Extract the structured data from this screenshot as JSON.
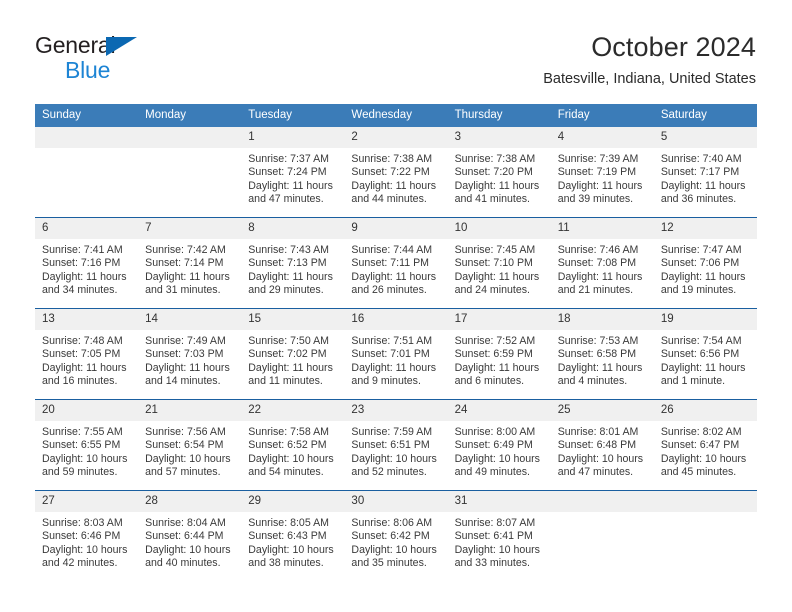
{
  "logo": {
    "word1": "General",
    "word2": "Blue",
    "triangle_color": "#0b68b2",
    "word2_color": "#1d84d4"
  },
  "header": {
    "title": "October 2024",
    "subtitle": "Batesville, Indiana, United States"
  },
  "theme": {
    "header_blue": "#3b7cb8",
    "row_rule": "#1a5fa0",
    "daynum_band": "#f0f0f0"
  },
  "calendar": {
    "weekdays": [
      "Sunday",
      "Monday",
      "Tuesday",
      "Wednesday",
      "Thursday",
      "Friday",
      "Saturday"
    ],
    "weeks": [
      [
        {
          "day": "",
          "blank": true
        },
        {
          "day": "",
          "blank": true
        },
        {
          "day": "1",
          "sunrise": "Sunrise: 7:37 AM",
          "sunset": "Sunset: 7:24 PM",
          "daylight": "Daylight: 11 hours and 47 minutes."
        },
        {
          "day": "2",
          "sunrise": "Sunrise: 7:38 AM",
          "sunset": "Sunset: 7:22 PM",
          "daylight": "Daylight: 11 hours and 44 minutes."
        },
        {
          "day": "3",
          "sunrise": "Sunrise: 7:38 AM",
          "sunset": "Sunset: 7:20 PM",
          "daylight": "Daylight: 11 hours and 41 minutes."
        },
        {
          "day": "4",
          "sunrise": "Sunrise: 7:39 AM",
          "sunset": "Sunset: 7:19 PM",
          "daylight": "Daylight: 11 hours and 39 minutes."
        },
        {
          "day": "5",
          "sunrise": "Sunrise: 7:40 AM",
          "sunset": "Sunset: 7:17 PM",
          "daylight": "Daylight: 11 hours and 36 minutes."
        }
      ],
      [
        {
          "day": "6",
          "sunrise": "Sunrise: 7:41 AM",
          "sunset": "Sunset: 7:16 PM",
          "daylight": "Daylight: 11 hours and 34 minutes."
        },
        {
          "day": "7",
          "sunrise": "Sunrise: 7:42 AM",
          "sunset": "Sunset: 7:14 PM",
          "daylight": "Daylight: 11 hours and 31 minutes."
        },
        {
          "day": "8",
          "sunrise": "Sunrise: 7:43 AM",
          "sunset": "Sunset: 7:13 PM",
          "daylight": "Daylight: 11 hours and 29 minutes."
        },
        {
          "day": "9",
          "sunrise": "Sunrise: 7:44 AM",
          "sunset": "Sunset: 7:11 PM",
          "daylight": "Daylight: 11 hours and 26 minutes."
        },
        {
          "day": "10",
          "sunrise": "Sunrise: 7:45 AM",
          "sunset": "Sunset: 7:10 PM",
          "daylight": "Daylight: 11 hours and 24 minutes."
        },
        {
          "day": "11",
          "sunrise": "Sunrise: 7:46 AM",
          "sunset": "Sunset: 7:08 PM",
          "daylight": "Daylight: 11 hours and 21 minutes."
        },
        {
          "day": "12",
          "sunrise": "Sunrise: 7:47 AM",
          "sunset": "Sunset: 7:06 PM",
          "daylight": "Daylight: 11 hours and 19 minutes."
        }
      ],
      [
        {
          "day": "13",
          "sunrise": "Sunrise: 7:48 AM",
          "sunset": "Sunset: 7:05 PM",
          "daylight": "Daylight: 11 hours and 16 minutes."
        },
        {
          "day": "14",
          "sunrise": "Sunrise: 7:49 AM",
          "sunset": "Sunset: 7:03 PM",
          "daylight": "Daylight: 11 hours and 14 minutes."
        },
        {
          "day": "15",
          "sunrise": "Sunrise: 7:50 AM",
          "sunset": "Sunset: 7:02 PM",
          "daylight": "Daylight: 11 hours and 11 minutes."
        },
        {
          "day": "16",
          "sunrise": "Sunrise: 7:51 AM",
          "sunset": "Sunset: 7:01 PM",
          "daylight": "Daylight: 11 hours and 9 minutes."
        },
        {
          "day": "17",
          "sunrise": "Sunrise: 7:52 AM",
          "sunset": "Sunset: 6:59 PM",
          "daylight": "Daylight: 11 hours and 6 minutes."
        },
        {
          "day": "18",
          "sunrise": "Sunrise: 7:53 AM",
          "sunset": "Sunset: 6:58 PM",
          "daylight": "Daylight: 11 hours and 4 minutes."
        },
        {
          "day": "19",
          "sunrise": "Sunrise: 7:54 AM",
          "sunset": "Sunset: 6:56 PM",
          "daylight": "Daylight: 11 hours and 1 minute."
        }
      ],
      [
        {
          "day": "20",
          "sunrise": "Sunrise: 7:55 AM",
          "sunset": "Sunset: 6:55 PM",
          "daylight": "Daylight: 10 hours and 59 minutes."
        },
        {
          "day": "21",
          "sunrise": "Sunrise: 7:56 AM",
          "sunset": "Sunset: 6:54 PM",
          "daylight": "Daylight: 10 hours and 57 minutes."
        },
        {
          "day": "22",
          "sunrise": "Sunrise: 7:58 AM",
          "sunset": "Sunset: 6:52 PM",
          "daylight": "Daylight: 10 hours and 54 minutes."
        },
        {
          "day": "23",
          "sunrise": "Sunrise: 7:59 AM",
          "sunset": "Sunset: 6:51 PM",
          "daylight": "Daylight: 10 hours and 52 minutes."
        },
        {
          "day": "24",
          "sunrise": "Sunrise: 8:00 AM",
          "sunset": "Sunset: 6:49 PM",
          "daylight": "Daylight: 10 hours and 49 minutes."
        },
        {
          "day": "25",
          "sunrise": "Sunrise: 8:01 AM",
          "sunset": "Sunset: 6:48 PM",
          "daylight": "Daylight: 10 hours and 47 minutes."
        },
        {
          "day": "26",
          "sunrise": "Sunrise: 8:02 AM",
          "sunset": "Sunset: 6:47 PM",
          "daylight": "Daylight: 10 hours and 45 minutes."
        }
      ],
      [
        {
          "day": "27",
          "sunrise": "Sunrise: 8:03 AM",
          "sunset": "Sunset: 6:46 PM",
          "daylight": "Daylight: 10 hours and 42 minutes."
        },
        {
          "day": "28",
          "sunrise": "Sunrise: 8:04 AM",
          "sunset": "Sunset: 6:44 PM",
          "daylight": "Daylight: 10 hours and 40 minutes."
        },
        {
          "day": "29",
          "sunrise": "Sunrise: 8:05 AM",
          "sunset": "Sunset: 6:43 PM",
          "daylight": "Daylight: 10 hours and 38 minutes."
        },
        {
          "day": "30",
          "sunrise": "Sunrise: 8:06 AM",
          "sunset": "Sunset: 6:42 PM",
          "daylight": "Daylight: 10 hours and 35 minutes."
        },
        {
          "day": "31",
          "sunrise": "Sunrise: 8:07 AM",
          "sunset": "Sunset: 6:41 PM",
          "daylight": "Daylight: 10 hours and 33 minutes."
        },
        {
          "day": "",
          "blank": true
        },
        {
          "day": "",
          "blank": true
        }
      ]
    ]
  }
}
